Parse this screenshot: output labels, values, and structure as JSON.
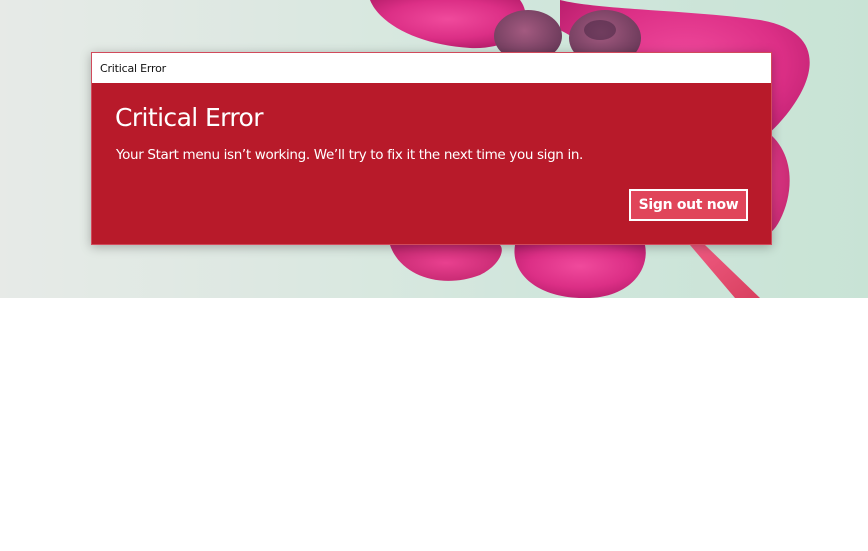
{
  "window": {
    "title": "Critical Error"
  },
  "dialog": {
    "heading": "Critical Error",
    "message": "Your Start menu isn’t working. We’ll try to fix it the next time you sign in.",
    "sign_out_label": "Sign out now"
  },
  "colors": {
    "dialog_background": "#b81a2a",
    "dialog_border": "#d14a5b",
    "button_background": "#e0455a",
    "button_border": "#ffffff",
    "text": "#ffffff",
    "titlebar_background": "#ffffff"
  },
  "wallpaper": {
    "subject": "pink-flower"
  }
}
